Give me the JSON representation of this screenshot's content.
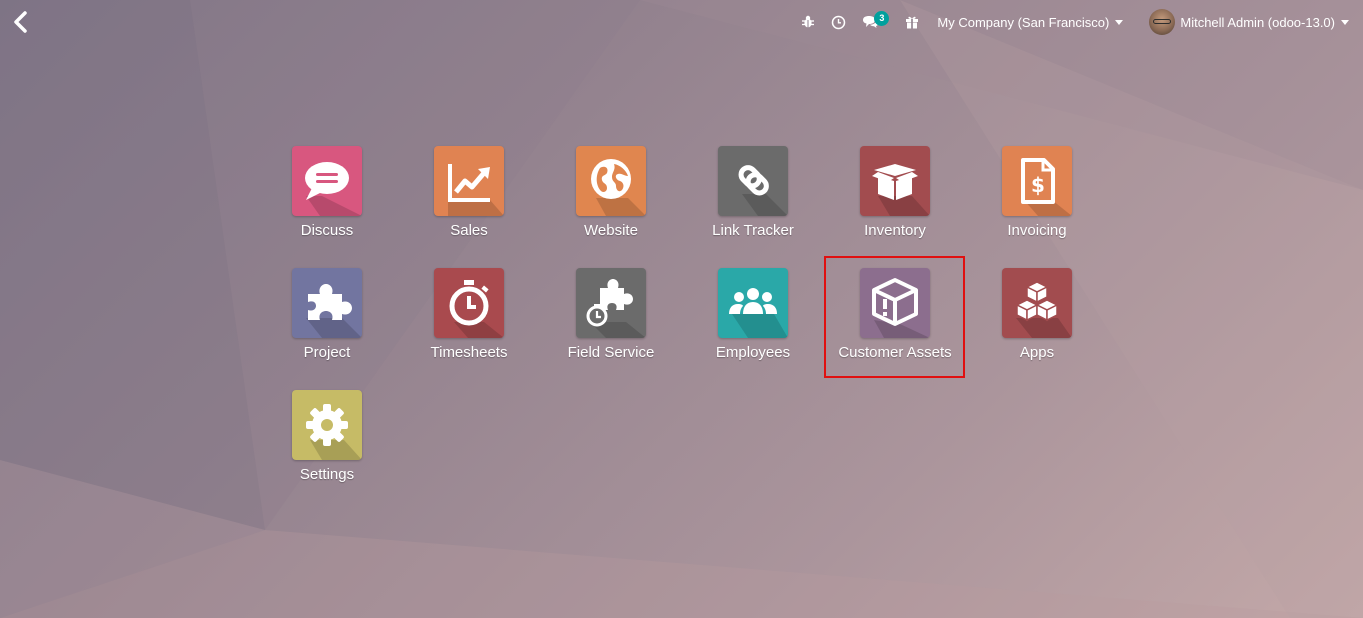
{
  "topbar": {
    "company": "My Company (San Francisco)",
    "user": "Mitchell Admin (odoo-13.0)",
    "message_count": "3",
    "icons": [
      "debug-bug-icon",
      "activity-clock-icon",
      "messages-chat-icon",
      "gift-icon"
    ]
  },
  "apps": [
    {
      "label": "Discuss",
      "color": "#d8577f",
      "icon": "chat-bubble-icon"
    },
    {
      "label": "Sales",
      "color": "#e08352",
      "icon": "trend-chart-icon"
    },
    {
      "label": "Website",
      "color": "#e0864f",
      "icon": "globe-icon"
    },
    {
      "label": "Link Tracker",
      "color": "#6b6b6b",
      "icon": "link-chain-icon"
    },
    {
      "label": "Inventory",
      "color": "#a24c4f",
      "icon": "open-box-icon"
    },
    {
      "label": "Invoicing",
      "color": "#e08352",
      "icon": "invoice-dollar-icon"
    },
    {
      "label": "Project",
      "color": "#7275a0",
      "icon": "puzzle-icon"
    },
    {
      "label": "Timesheets",
      "color": "#a94a4e",
      "icon": "stopwatch-icon"
    },
    {
      "label": "Field Service",
      "color": "#6b6b6b",
      "icon": "puzzle-stopwatch-icon"
    },
    {
      "label": "Employees",
      "color": "#2aa8a8",
      "icon": "users-group-icon"
    },
    {
      "label": "Customer Assets",
      "color": "#8c6e8e",
      "icon": "box-exclamation-icon"
    },
    {
      "label": "Apps",
      "color": "#a24c4f",
      "icon": "cubes-icon"
    },
    {
      "label": "Settings",
      "color": "#c6bb66",
      "icon": "gear-icon"
    }
  ],
  "colors": {
    "highlight_border": "#e01010",
    "badge": "#00a09d"
  }
}
